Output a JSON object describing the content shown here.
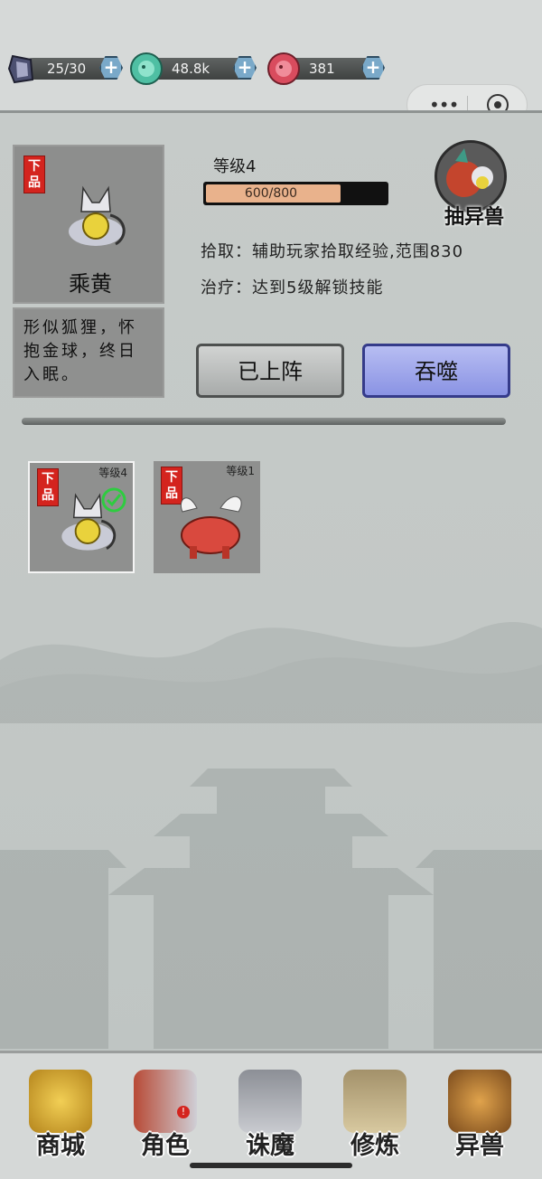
{
  "resources": [
    {
      "icon": "crystal-icon",
      "value": "25/30",
      "color": "#6b6f8f"
    },
    {
      "icon": "jade-dragon-icon",
      "value": "48.8k",
      "color": "#4fbfa3"
    },
    {
      "icon": "red-beast-icon",
      "value": "381",
      "color": "#d94c5e"
    }
  ],
  "pet": {
    "grade": "下品",
    "name": "乘黄",
    "description": "形似狐狸，怀抱金球，终日入眠。",
    "level_label": "等级4",
    "exp_text": "600/800",
    "exp_progress": 0.75,
    "skills": [
      "拾取：辅助玩家拾取经验,范围830",
      "治疗：达到5级解锁技能"
    ]
  },
  "draw_button": "抽异兽",
  "buttons": {
    "deployed": "已上阵",
    "devour": "吞噬"
  },
  "inventory": [
    {
      "grade": "下品",
      "level": "等级4",
      "selected": true
    },
    {
      "grade": "下品",
      "level": "等级1",
      "selected": false
    }
  ],
  "nav": [
    {
      "label": "商城",
      "icon": "golden-warrior-icon"
    },
    {
      "label": "角色",
      "icon": "characters-icon"
    },
    {
      "label": "诛魔",
      "icon": "sword-icon"
    },
    {
      "label": "修炼",
      "icon": "scroll-icon"
    },
    {
      "label": "异兽",
      "icon": "winged-beast-icon"
    }
  ]
}
